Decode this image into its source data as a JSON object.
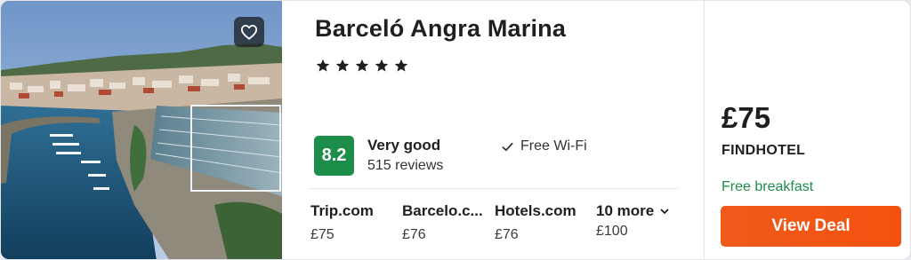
{
  "hotel": {
    "name": "Barceló Angra Marina",
    "stars": 5,
    "rating": "8.2",
    "rating_text": "Very good",
    "reviews": "515 reviews",
    "amenity": "Free Wi-Fi"
  },
  "providers": [
    {
      "name": "Trip.com",
      "price": "£75"
    },
    {
      "name": "Barcelo.c...",
      "price": "£76"
    },
    {
      "name": "Hotels.com",
      "price": "£76"
    }
  ],
  "more_providers": {
    "label": "10 more",
    "price": "£100"
  },
  "deal": {
    "price": "£75",
    "provider": "FINDHOTEL",
    "perk": "Free breakfast",
    "button_label": "View Deal"
  },
  "icons": {
    "favorite": "heart-icon",
    "star": "star-icon",
    "amenity": "check-icon",
    "more": "chevron-down-icon"
  },
  "colors": {
    "rating_badge": "#1d8d4a",
    "perk_text": "#1d8d4a",
    "deal_button": "#f4510f"
  }
}
